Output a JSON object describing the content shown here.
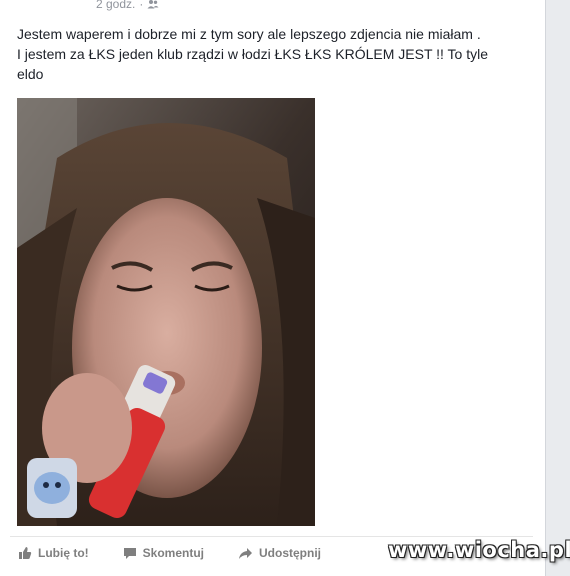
{
  "post": {
    "timestamp": "2 godz.",
    "separator": "·",
    "audience_icon": "friends-icon",
    "text_lines": [
      "Jestem waperem i dobrze mi z tym sory ale lepszego zdjencia nie miałam .",
      "I jestem za ŁKS jeden klub rządzi w łodzi ŁKS ŁKS KRÓLEM JEST !! To tyle",
      "eldo"
    ]
  },
  "actions": {
    "like_label": "Lubię to!",
    "comment_label": "Skomentuj",
    "share_label": "Udostępnij"
  },
  "watermark": {
    "text": "www.wiocha.pl"
  },
  "colors": {
    "text": "#1d2129",
    "meta": "#90949c",
    "action": "#7f7f7f",
    "background": "#e9ebee"
  }
}
